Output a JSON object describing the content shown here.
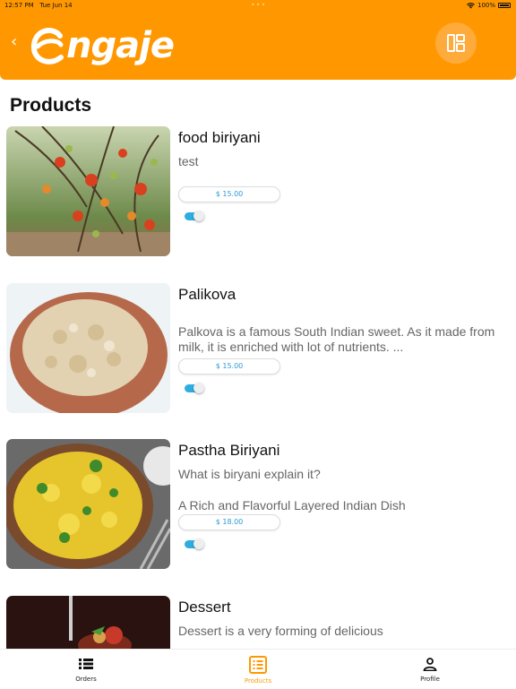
{
  "status_bar": {
    "time": "12:57 PM",
    "date": "Tue Jun 14",
    "battery": "100%"
  },
  "header": {
    "app_name": "ngaje",
    "logo_letter": "E",
    "back_icon": "chevron-left-icon",
    "action_icon": "layout-grid-icon",
    "color": "#ff9800"
  },
  "page": {
    "title": "Products"
  },
  "products": [
    {
      "name": "food biriyani",
      "description": "test",
      "description2": "",
      "price": "$ 15.00",
      "enabled": true
    },
    {
      "name": "Palikova",
      "description": "",
      "description2": "Palkova is a famous South Indian sweet. As it made from milk, it is enriched with lot of nutrients. ...",
      "price": "$ 15.00",
      "enabled": true
    },
    {
      "name": "Pastha Biriyani",
      "description": "What is biryani explain it?",
      "description2": "A Rich and Flavorful Layered Indian Dish",
      "price": "$ 18.00",
      "enabled": true
    },
    {
      "name": "Dessert",
      "description": "Dessert is a very forming of delicious",
      "description2": "",
      "price": "",
      "enabled": true
    }
  ],
  "tabbar": {
    "tabs": [
      {
        "label": "Orders",
        "icon": "list-icon",
        "active": false
      },
      {
        "label": "Products",
        "icon": "products-icon",
        "active": true
      },
      {
        "label": "Profile",
        "icon": "person-icon",
        "active": false
      }
    ],
    "accent": "#ff9800"
  }
}
